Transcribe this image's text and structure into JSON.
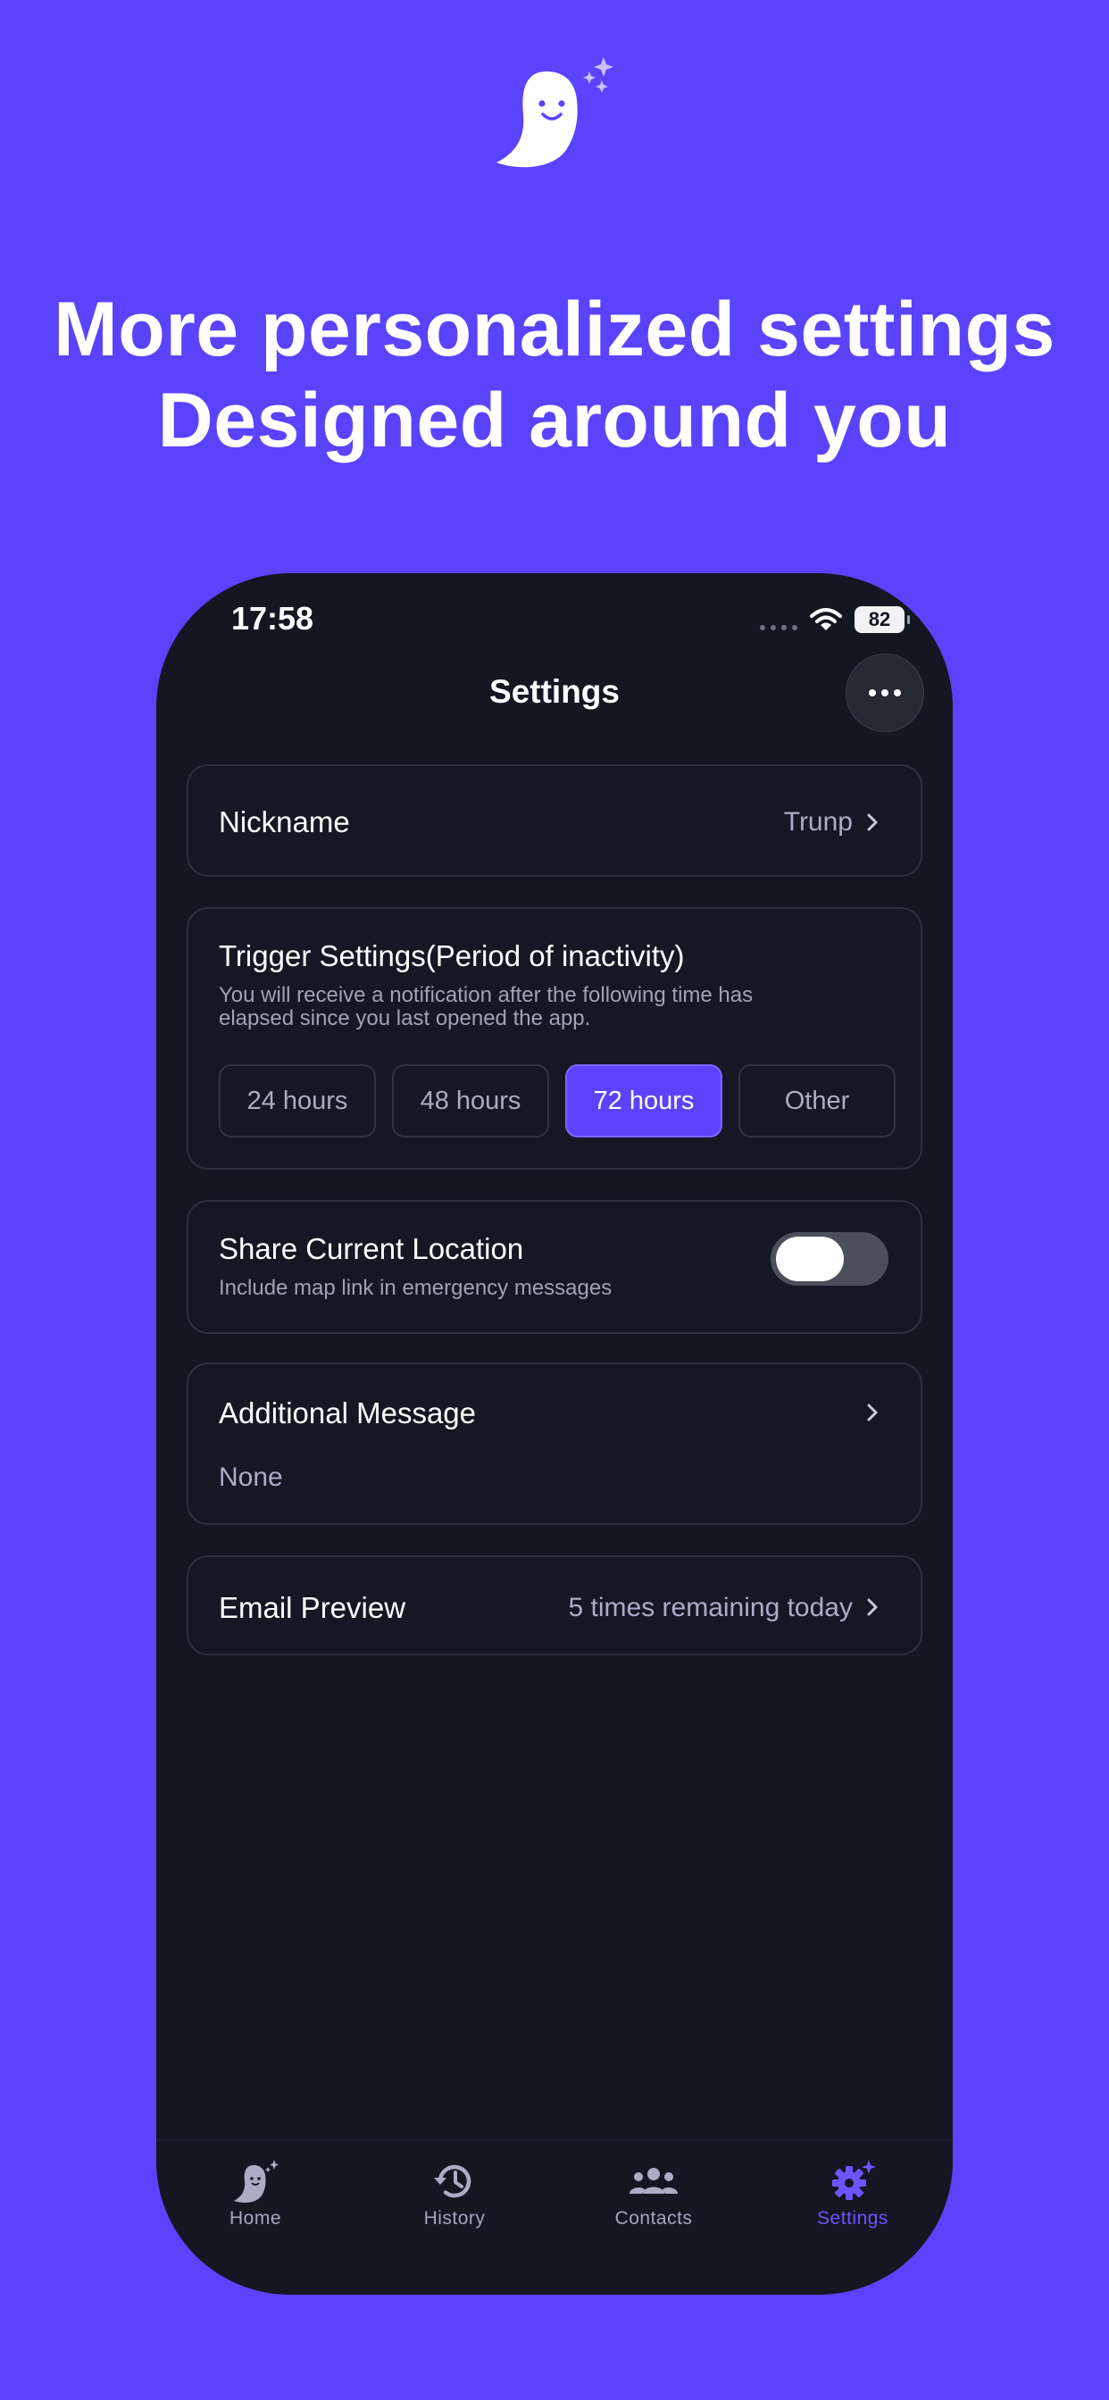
{
  "hero": {
    "line1": "More personalized settings",
    "line2": "Designed around you"
  },
  "status": {
    "time": "17:58",
    "battery": "82"
  },
  "nav": {
    "title": "Settings",
    "more_icon": "more-horizontal-icon"
  },
  "nickname": {
    "label": "Nickname",
    "value": "Trunp"
  },
  "trigger": {
    "title": "Trigger Settings(Period of inactivity)",
    "desc_line1": "You will receive a notification after the following time has",
    "desc_line2": "elapsed since you last opened the app.",
    "options": [
      "24 hours",
      "48 hours",
      "72 hours",
      "Other"
    ],
    "selected": "72 hours"
  },
  "location": {
    "title": "Share Current Location",
    "desc": "Include map link in emergency messages",
    "enabled": false
  },
  "additional": {
    "title": "Additional Message",
    "value": "None"
  },
  "email": {
    "title": "Email Preview",
    "value": "5 times remaining today"
  },
  "tabs": [
    {
      "label": "Home",
      "icon": "ghost-icon"
    },
    {
      "label": "History",
      "icon": "history-icon"
    },
    {
      "label": "Contacts",
      "icon": "contacts-icon"
    },
    {
      "label": "Settings",
      "icon": "settings-gear-icon"
    }
  ],
  "colors": {
    "background": "#5a43fc",
    "accent": "#5a43fc",
    "panel": "#121722"
  }
}
